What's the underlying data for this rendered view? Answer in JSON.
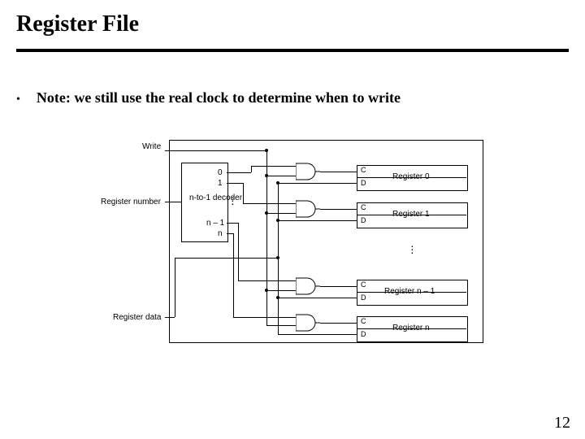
{
  "title": "Register File",
  "bullet": "Note:  we still use the real clock to determine when to write",
  "pagenum": "12",
  "diagram": {
    "inputs": {
      "write": "Write",
      "regnum": "Register number",
      "regdata": "Register data"
    },
    "decoder": {
      "name": "n-to-1 decoder",
      "outs": [
        "0",
        "1",
        "n – 1",
        "n"
      ]
    },
    "registers": [
      "Register 0",
      "Register 1",
      "Register n – 1",
      "Register n"
    ],
    "ports": {
      "C": "C",
      "D": "D"
    }
  }
}
